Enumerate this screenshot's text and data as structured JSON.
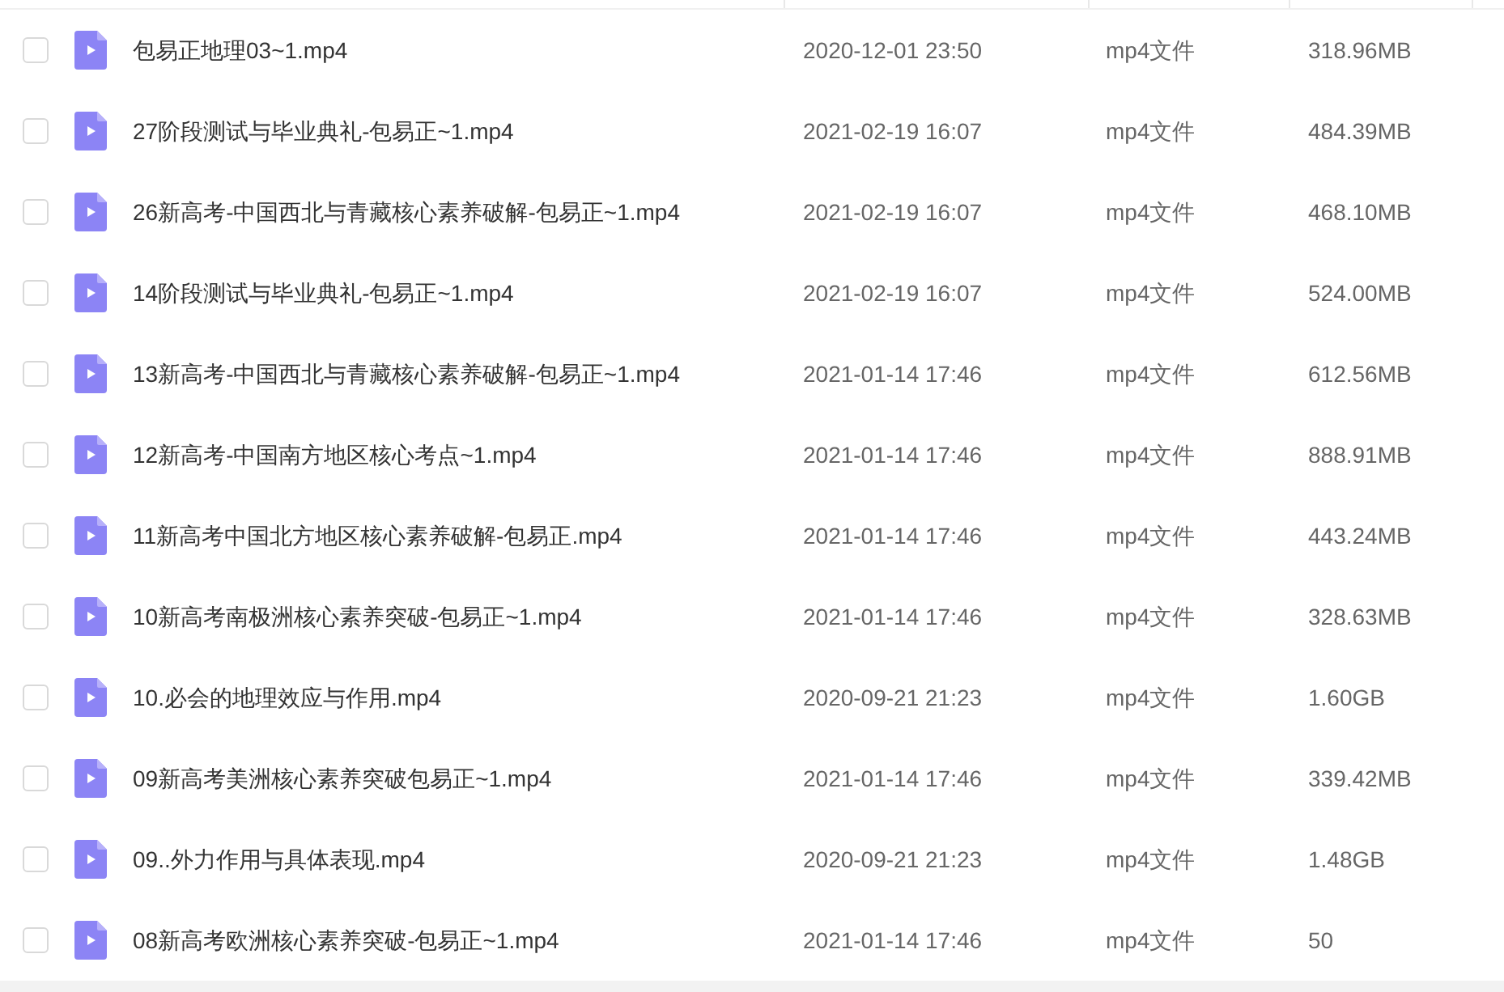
{
  "files": [
    {
      "checked": false,
      "name": "包易正地理03~1.mp4",
      "modified": "2020-12-01 23:50",
      "type": "mp4文件",
      "size": "318.96MB"
    },
    {
      "checked": false,
      "name": "27阶段测试与毕业典礼-包易正~1.mp4",
      "modified": "2021-02-19 16:07",
      "type": "mp4文件",
      "size": "484.39MB"
    },
    {
      "checked": false,
      "name": "26新高考-中国西北与青藏核心素养破解-包易正~1.mp4",
      "modified": "2021-02-19 16:07",
      "type": "mp4文件",
      "size": "468.10MB"
    },
    {
      "checked": false,
      "name": "14阶段测试与毕业典礼-包易正~1.mp4",
      "modified": "2021-02-19 16:07",
      "type": "mp4文件",
      "size": "524.00MB"
    },
    {
      "checked": false,
      "name": "13新高考-中国西北与青藏核心素养破解-包易正~1.mp4",
      "modified": "2021-01-14 17:46",
      "type": "mp4文件",
      "size": "612.56MB"
    },
    {
      "checked": false,
      "name": "12新高考-中国南方地区核心考点~1.mp4",
      "modified": "2021-01-14 17:46",
      "type": "mp4文件",
      "size": "888.91MB"
    },
    {
      "checked": false,
      "name": "11新高考中国北方地区核心素养破解-包易正.mp4",
      "modified": "2021-01-14 17:46",
      "type": "mp4文件",
      "size": "443.24MB"
    },
    {
      "checked": false,
      "name": "10新高考南极洲核心素养突破-包易正~1.mp4",
      "modified": "2021-01-14 17:46",
      "type": "mp4文件",
      "size": "328.63MB"
    },
    {
      "checked": false,
      "name": "10.必会的地理效应与作用.mp4",
      "modified": "2020-09-21 21:23",
      "type": "mp4文件",
      "size": "1.60GB"
    },
    {
      "checked": false,
      "name": "09新高考美洲核心素养突破包易正~1.mp4",
      "modified": "2021-01-14 17:46",
      "type": "mp4文件",
      "size": "339.42MB"
    },
    {
      "checked": false,
      "name": "09..外力作用与具体表现.mp4",
      "modified": "2020-09-21 21:23",
      "type": "mp4文件",
      "size": "1.48GB"
    },
    {
      "checked": false,
      "name": "08新高考欧洲核心素养突破-包易正~1.mp4",
      "modified": "2021-01-14 17:46",
      "type": "mp4文件",
      "size": "50"
    }
  ]
}
